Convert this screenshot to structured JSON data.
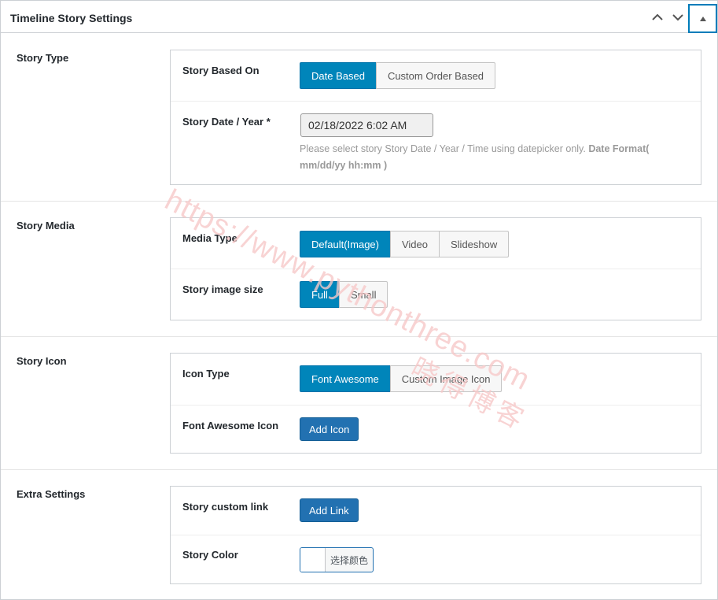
{
  "metabox": {
    "title": "Timeline Story Settings",
    "icons": {
      "move_up": "chevron-up-icon",
      "move_down": "chevron-down-icon",
      "toggle": "triangle-up-icon"
    }
  },
  "sections": {
    "story_type": {
      "label": "Story Type",
      "story_based_on": {
        "label": "Story Based On",
        "options": [
          "Date Based",
          "Custom Order Based"
        ],
        "selected": "Date Based"
      },
      "story_date": {
        "label": "Story Date / Year *",
        "value": "02/18/2022 6:02 AM",
        "help_text": "Please select story Story Date / Year / Time using datepicker only.",
        "help_bold": "Date Format( mm/dd/yy hh:mm )"
      }
    },
    "story_media": {
      "label": "Story Media",
      "media_type": {
        "label": "Media Type",
        "options": [
          "Default(Image)",
          "Video",
          "Slideshow"
        ],
        "selected": "Default(Image)"
      },
      "image_size": {
        "label": "Story image size",
        "options": [
          "Full",
          "Small"
        ],
        "selected": "Full"
      }
    },
    "story_icon": {
      "label": "Story Icon",
      "icon_type": {
        "label": "Icon Type",
        "options": [
          "Font Awesome",
          "Custom Image Icon"
        ],
        "selected": "Font Awesome"
      },
      "fa_icon": {
        "label": "Font Awesome Icon",
        "button": "Add Icon"
      }
    },
    "extra": {
      "label": "Extra Settings",
      "custom_link": {
        "label": "Story custom link",
        "button": "Add Link"
      },
      "color": {
        "label": "Story Color",
        "button": "选择颜色"
      }
    }
  },
  "watermark": {
    "url": "https://www.pythonthree.com",
    "brand": "晓得博客"
  },
  "colors": {
    "accent": "#0085ba",
    "primary_button": "#2271b1",
    "border": "#ccd0d4",
    "watermark": "#f7c9c9"
  }
}
